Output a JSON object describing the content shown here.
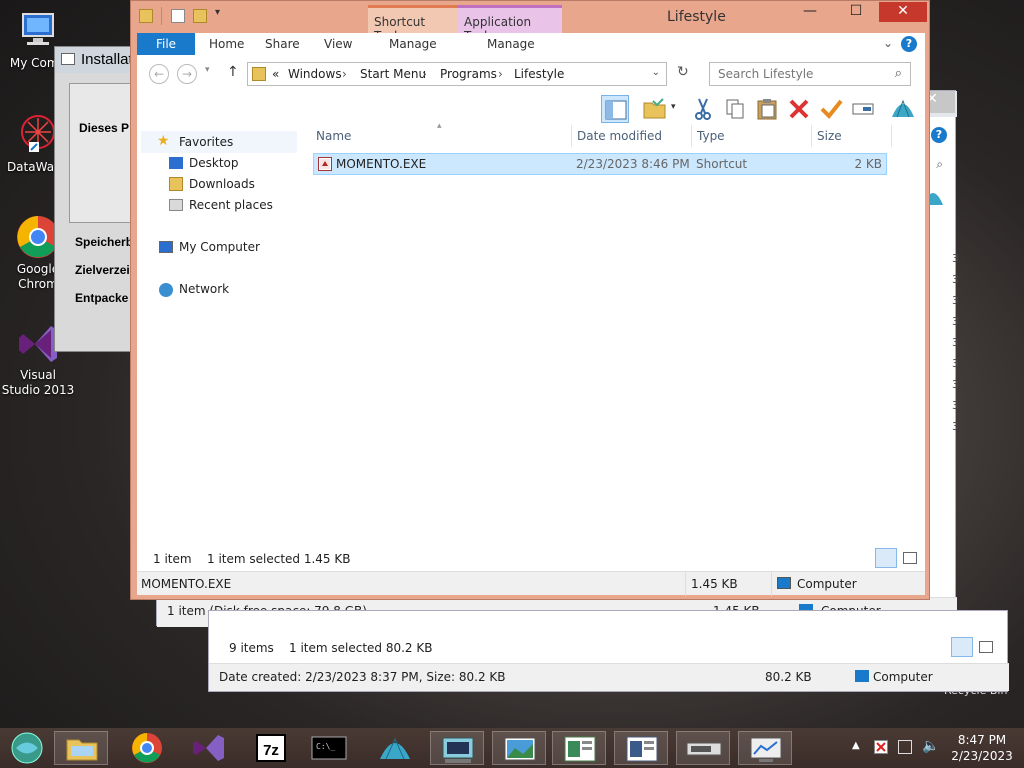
{
  "desktop": {
    "icons": [
      {
        "label": "My Comp"
      },
      {
        "label": "DataWage"
      },
      {
        "label": "Google Chrom"
      },
      {
        "label": "Visual Studio 2013"
      }
    ],
    "recycle_label": "Recycle Bin"
  },
  "installer": {
    "title": "Installat",
    "label_dieses": "Dieses P",
    "label_speicher": "Speicherb",
    "label_ziel": "Zielverzei",
    "label_entpack": "Entpacke"
  },
  "back_window_1": {
    "status_text": "1 item (Disk free space: 79.8 GB)",
    "size": "1.45 KB",
    "location": "Computer"
  },
  "back_window_2": {
    "items_count": "9 items",
    "selected": "1 item selected  80.2 KB",
    "details": "Date created: 2/23/2023 8:37 PM, Size: 80.2 KB",
    "size": "80.2 KB",
    "location": "Computer",
    "row_marks": [
      "3",
      "3",
      "3",
      "3",
      "3",
      "3",
      "3",
      "3",
      "3"
    ]
  },
  "window": {
    "title": "Lifestyle",
    "context_tabs": {
      "shortcut": "Shortcut Tools",
      "app": "Application Tools"
    },
    "ribbon_tabs": {
      "file": "File",
      "home": "Home",
      "share": "Share",
      "view": "View",
      "manage1": "Manage",
      "manage2": "Manage"
    },
    "breadcrumb": {
      "prefix": "«",
      "items": [
        "Windows",
        "Start Menu",
        "Programs",
        "Lifestyle"
      ]
    },
    "search_placeholder": "Search Lifestyle",
    "nav": {
      "favorites": "Favorites",
      "desktop": "Desktop",
      "downloads": "Downloads",
      "recent": "Recent places",
      "computer": "My Computer",
      "network": "Network"
    },
    "columns": {
      "name": "Name",
      "date": "Date modified",
      "type": "Type",
      "size": "Size"
    },
    "files": [
      {
        "name": "MOMENTO.EXE",
        "date": "2/23/2023 8:46 PM",
        "type": "Shortcut",
        "size": "2 KB"
      }
    ],
    "status": {
      "count": "1 item",
      "selected": "1 item selected  1.45 KB"
    },
    "details": {
      "name": "MOMENTO.EXE",
      "size": "1.45 KB",
      "location": "Computer"
    }
  },
  "taskbar": {
    "clock_time": "8:47 PM",
    "clock_date": "2/23/2023"
  },
  "colors": {
    "accent": "#1979ca",
    "window_frame": "#e8a68c",
    "close": "#c7382c",
    "selection": "#cce8ff"
  }
}
